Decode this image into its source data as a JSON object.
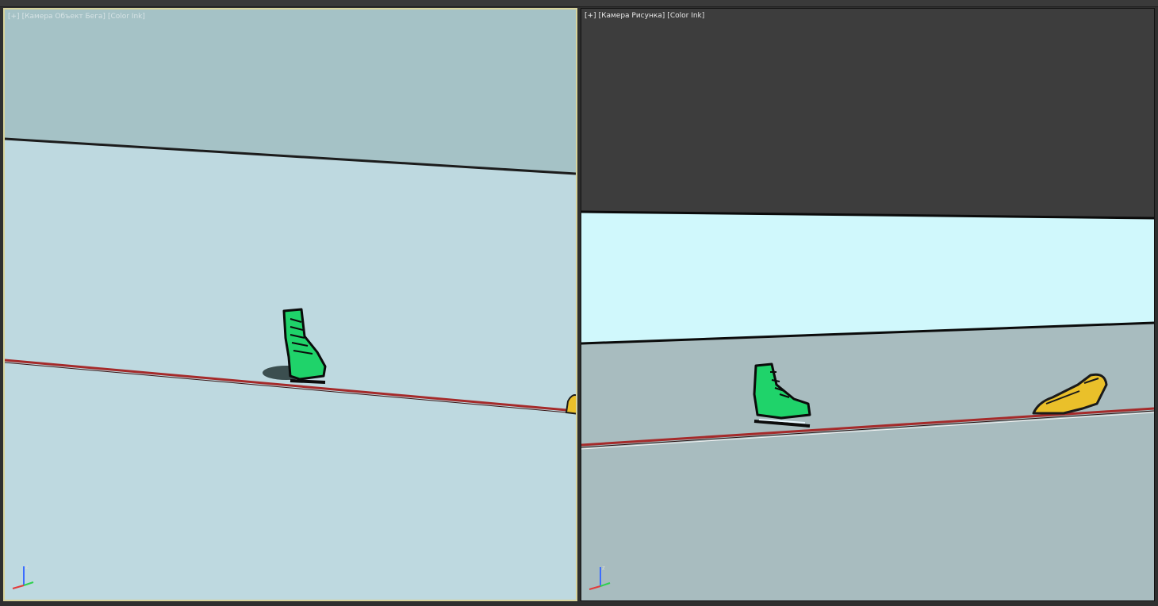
{
  "app": {
    "colors": {
      "left_wall": "#a5c2c6",
      "left_floor": "#bed9e0",
      "right_top": "#3d3d3d",
      "right_sky": "#d0f8fc",
      "right_floor": "#a8bcbf",
      "green_skate": "#1fd36a",
      "yellow_skate": "#eac02a",
      "red_line": "#a52a2a",
      "active_border": "#d8d49c"
    }
  },
  "viewports": {
    "left": {
      "label_parts": [
        "[+]",
        "[Камера Объект Бега]",
        "[Color Ink]"
      ],
      "objects": {
        "green_skate": "green-skate-icon",
        "yellow_skate": "yellow-skate-icon",
        "axis": "axis-gizmo-icon"
      }
    },
    "right": {
      "label_parts": [
        "[+]",
        "[Камера Рисунка]",
        "[Color Ink]"
      ],
      "objects": {
        "green_skate": "green-skate-icon",
        "yellow_skate": "yellow-skate-icon",
        "axis": "axis-gizmo-icon"
      }
    }
  }
}
